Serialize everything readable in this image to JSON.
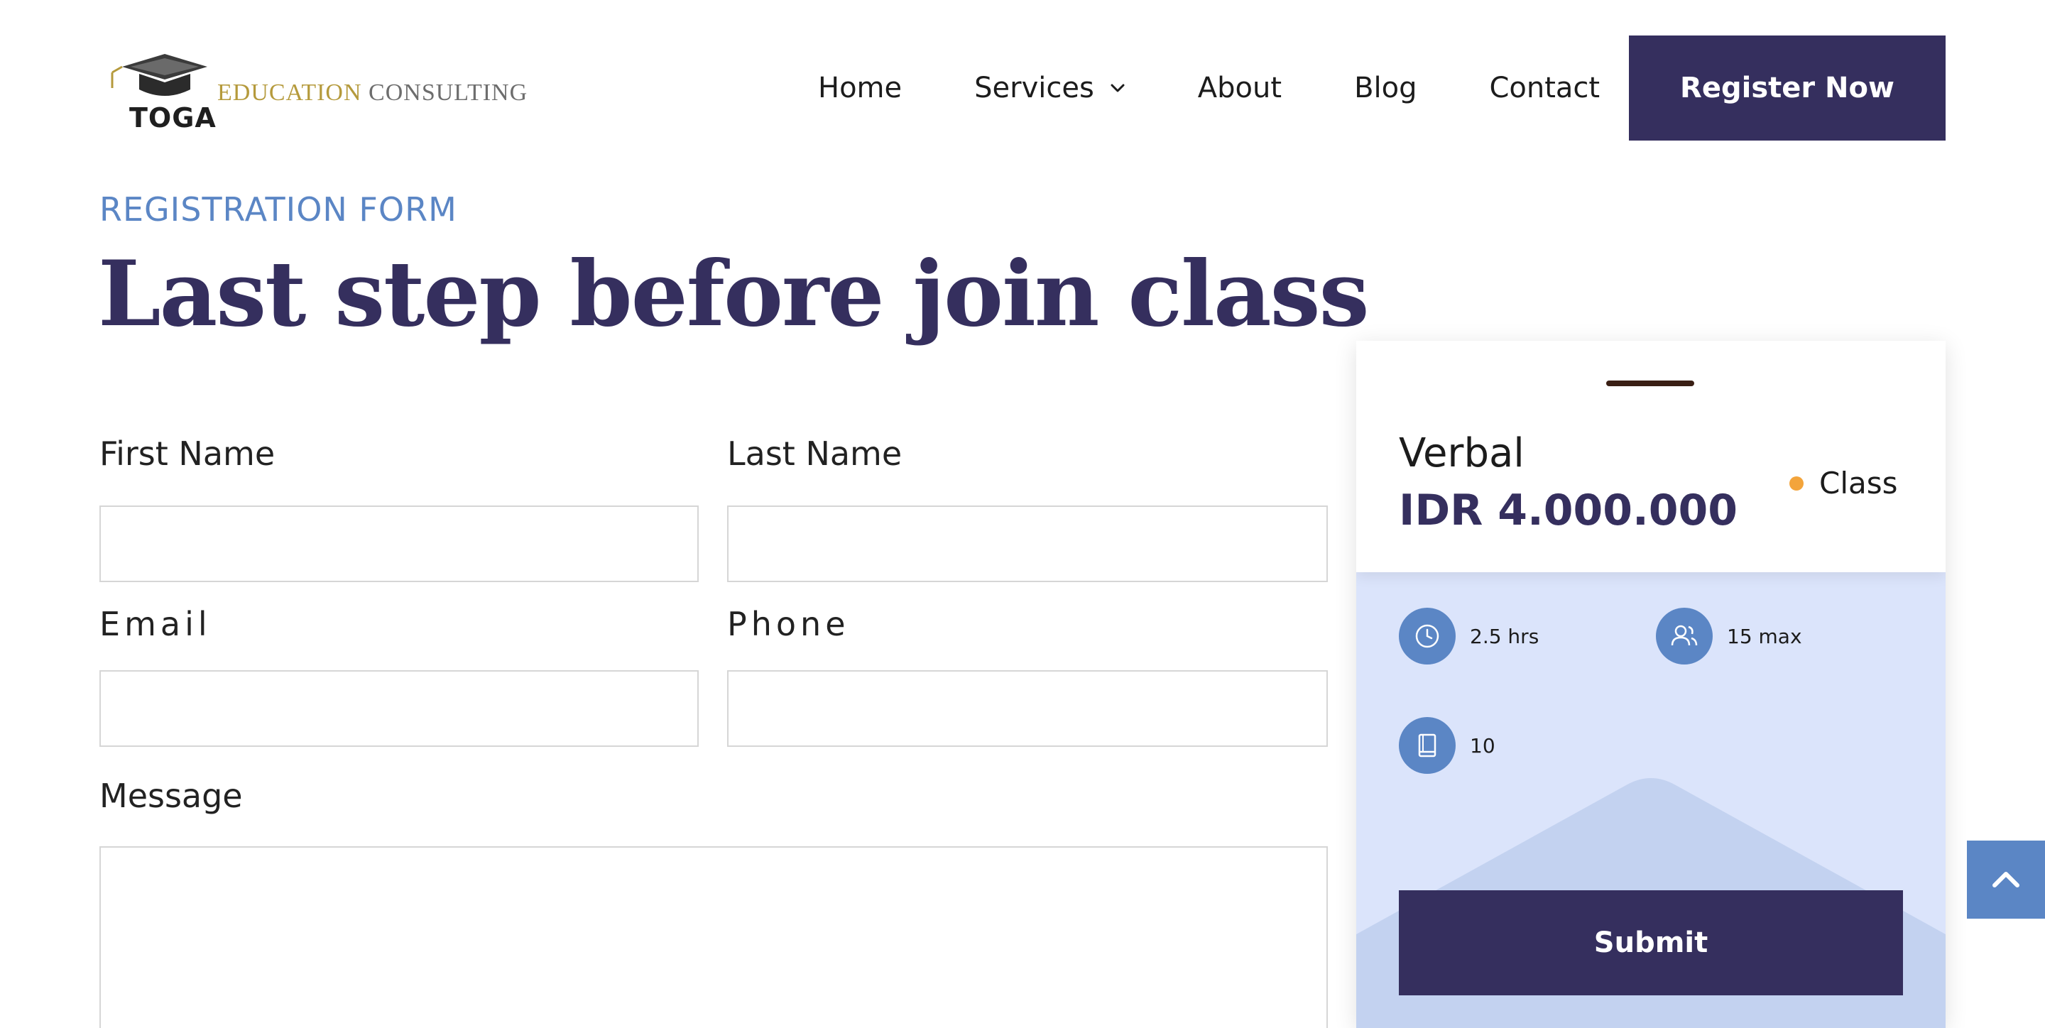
{
  "brand": {
    "mark_text": "TOGA",
    "name_part1": "EDUCATION",
    "name_part2": "CONSULTING"
  },
  "nav": {
    "items": [
      {
        "label": "Home"
      },
      {
        "label": "Services",
        "has_dropdown": true
      },
      {
        "label": "About"
      },
      {
        "label": "Blog"
      },
      {
        "label": "Contact"
      }
    ],
    "cta_label": "Register Now"
  },
  "heading": {
    "eyebrow": "REGISTRATION FORM",
    "title": "Last step before join class"
  },
  "form": {
    "first_name_label": "First Name",
    "last_name_label": "Last Name",
    "email_label": "Email",
    "phone_label": "Phone",
    "message_label": "Message",
    "first_name_value": "",
    "last_name_value": "",
    "email_value": "",
    "phone_value": "",
    "message_value": ""
  },
  "class_card": {
    "name": "Verbal",
    "price": "IDR 4.000.000",
    "badge": "Class",
    "features": [
      {
        "icon": "clock-icon",
        "text": "2.5 hrs"
      },
      {
        "icon": "users-icon",
        "text": "15 max"
      },
      {
        "icon": "book-icon",
        "text": "10"
      }
    ],
    "submit_label": "Submit"
  },
  "colors": {
    "primary": "#352f5e",
    "accent_blue": "#5b86c5",
    "card_bg": "#dbe4fb",
    "badge_dot": "#f3a43b",
    "logo_gold": "#b59a3c"
  }
}
